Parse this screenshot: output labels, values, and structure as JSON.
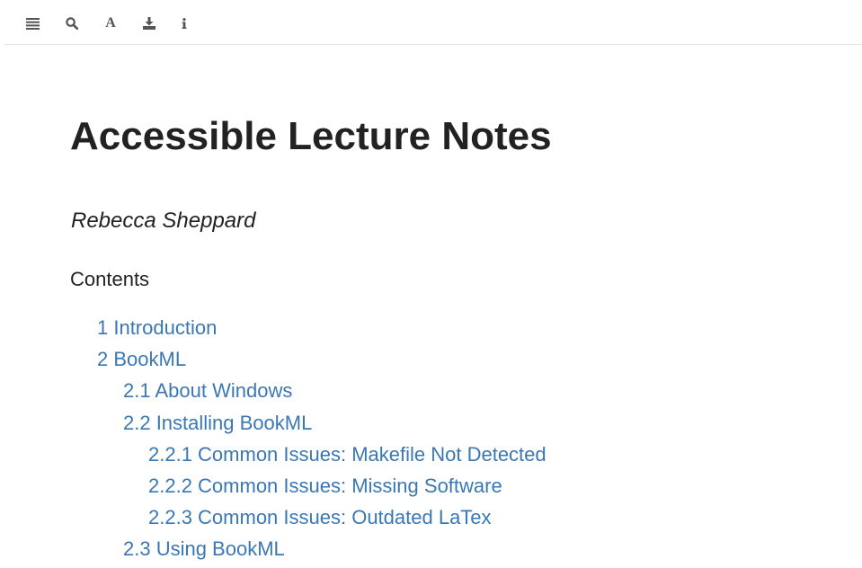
{
  "toolbar": {
    "buttons": [
      {
        "name": "toc-toggle",
        "icon": "list-icon"
      },
      {
        "name": "search",
        "icon": "search-icon"
      },
      {
        "name": "font-settings",
        "icon": "font-icon",
        "glyph": "A"
      },
      {
        "name": "download",
        "icon": "download-icon"
      },
      {
        "name": "info",
        "icon": "info-icon"
      }
    ]
  },
  "document": {
    "title": "Accessible Lecture Notes",
    "author": "Rebecca Sheppard",
    "contents_heading": "Contents"
  },
  "toc": {
    "items": [
      {
        "label": "1 Introduction",
        "level": 1
      },
      {
        "label": "2 BookML",
        "level": 1
      },
      {
        "label": "2.1 About Windows",
        "level": 2
      },
      {
        "label": "2.2 Installing BookML",
        "level": 2
      },
      {
        "label": "2.2.1 Common Issues: Makefile Not Detected",
        "level": 3
      },
      {
        "label": "2.2.2 Common Issues: Missing Software",
        "level": 3
      },
      {
        "label": "2.2.3 Common Issues: Outdated LaTex",
        "level": 3
      },
      {
        "label": "2.3 Using BookML",
        "level": 2
      }
    ]
  },
  "colors": {
    "link": "#3a78b5",
    "text": "#222222",
    "toolbar_icon": "#555555",
    "divider": "#e6e6e6"
  }
}
